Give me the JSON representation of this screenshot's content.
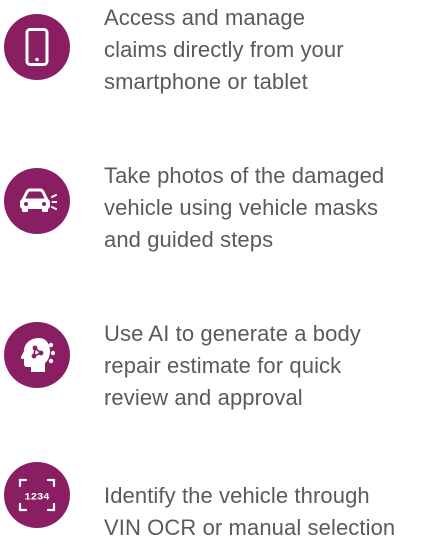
{
  "colors": {
    "accent": "#8a1e63",
    "text": "#5a5a5a",
    "icon_fg": "#ffffff"
  },
  "features": [
    {
      "icon": "smartphone-icon",
      "lines": [
        "Access and manage",
        "claims directly from your",
        "smartphone or tablet"
      ]
    },
    {
      "icon": "car-camera-icon",
      "lines": [
        "Take photos of the damaged",
        "vehicle using vehicle masks",
        "and guided steps"
      ]
    },
    {
      "icon": "ai-head-icon",
      "lines": [
        "Use AI to generate a body",
        "repair estimate for quick",
        "review and approval"
      ]
    },
    {
      "icon": "vin-scan-icon",
      "scan_text": "1234",
      "lines": [
        "Identify the vehicle through",
        "VIN OCR or manual selection"
      ]
    }
  ]
}
